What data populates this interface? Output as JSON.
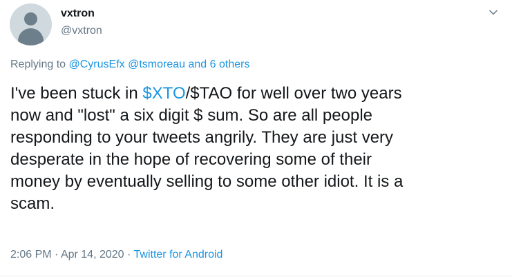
{
  "user": {
    "display_name": "vxtron",
    "handle": "@vxtron"
  },
  "reply": {
    "prefix": "Replying to",
    "mentions": [
      "@CyrusEfx",
      "@tsmoreau"
    ],
    "conj": "and",
    "others": "6 others"
  },
  "tweet": {
    "lines": [
      "/$TAO for well over two years",
      "now and \"lost\" a six digit $ sum. So are all people",
      "responding to your tweets angrily. They are just very",
      "desperate in the hope of recovering some of their",
      "money by eventually selling to some other idiot. It is a",
      "scam."
    ],
    "lead": "I've been stuck in ",
    "cashtag": "$XTO"
  },
  "meta": {
    "time": "2:06 PM",
    "sep": "·",
    "date": "Apr 14, 2020",
    "source": "Twitter for Android"
  },
  "icons": {
    "caret": "chevron-down-icon",
    "avatar": "default-avatar"
  },
  "colors": {
    "link": "#1b95e0",
    "muted": "#657786",
    "text": "#14171a"
  }
}
